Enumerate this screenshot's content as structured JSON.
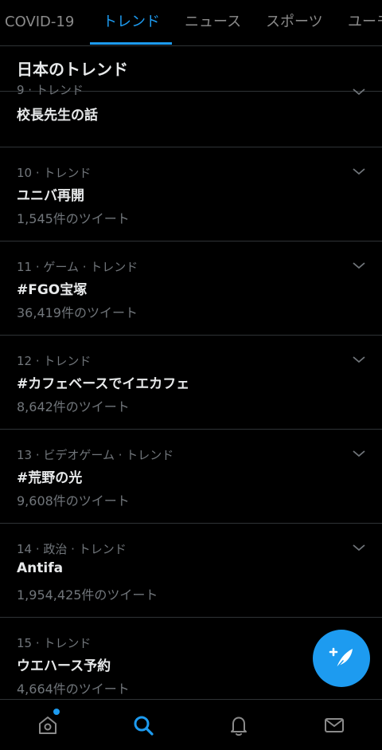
{
  "tabs": [
    {
      "label": "COVID-19"
    },
    {
      "label": "トレンド"
    },
    {
      "label": "ニュース"
    },
    {
      "label": "スポーツ"
    },
    {
      "label": "ユーモ"
    }
  ],
  "section": {
    "title": "日本のトレンド"
  },
  "trends": [
    {
      "meta": "9 · トレンド",
      "name": "校長先生の話",
      "count": ""
    },
    {
      "meta": "10 · トレンド",
      "name": "ユニバ再開",
      "count": "1,545件のツイート"
    },
    {
      "meta": "11 · ゲーム · トレンド",
      "name": "#FGO宝塚",
      "count": "36,419件のツイート"
    },
    {
      "meta": "12 · トレンド",
      "name": "#カフェベースでイエカフェ",
      "count": "8,642件のツイート"
    },
    {
      "meta": "13 · ビデオゲーム · トレンド",
      "name": "#荒野の光",
      "count": "9,608件のツイート"
    },
    {
      "meta": "14 · 政治 · トレンド",
      "name": "Antifa",
      "count": "1,954,425件のツイート"
    },
    {
      "meta": "15 · トレンド",
      "name": "ウエハース予約",
      "count": "4,664件のツイート"
    }
  ],
  "colors": {
    "accent": "#1d9bf0",
    "background": "#000000",
    "muted": "#71767b"
  },
  "nav": {
    "items": [
      "home-icon",
      "search-icon",
      "bell-icon",
      "mail-icon"
    ],
    "active": "search-icon"
  }
}
